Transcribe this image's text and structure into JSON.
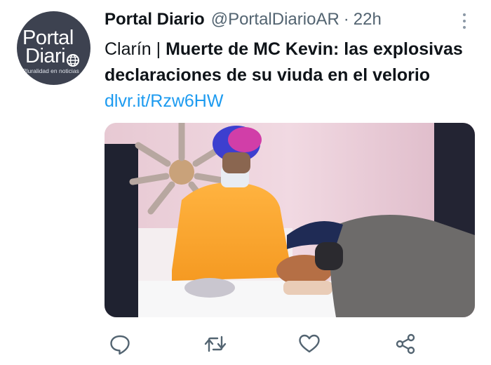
{
  "account": {
    "name": "Portal Diario",
    "handle": "@PortalDiarioAR",
    "separator": "·",
    "time": "22h",
    "avatar": {
      "line1": "Portal",
      "line2": "Diari",
      "tagline": "Pluralidad en noticias",
      "bg_color": "#3d4250"
    }
  },
  "tweet": {
    "source": "Clarín | ",
    "headline": "Muerte de MC Kevin: las explosivas declaraciones de su viuda en el velorio",
    "link": "dlvr.it/Rzw6HW",
    "link_color": "#1d9bf0"
  },
  "media": {
    "description_icon": "photo-image"
  },
  "actions": [
    {
      "name": "reply",
      "icon": "speech-bubble-icon"
    },
    {
      "name": "retweet",
      "icon": "retweet-icon"
    },
    {
      "name": "like",
      "icon": "heart-icon"
    },
    {
      "name": "share",
      "icon": "share-nodes-icon"
    }
  ],
  "more_icon": "vertical-dots-icon",
  "colors": {
    "text": "#0f1419",
    "secondary": "#536471",
    "accent": "#1d9bf0"
  }
}
